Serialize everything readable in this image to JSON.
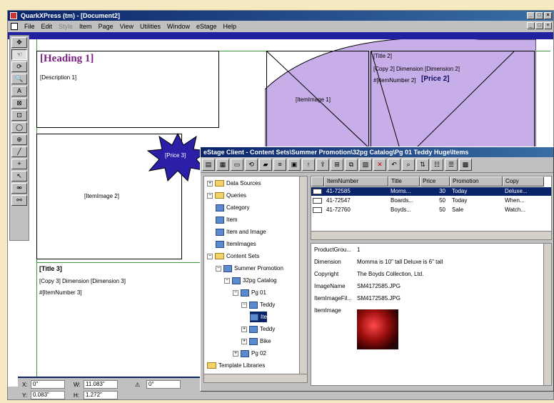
{
  "window": {
    "title": "QuarkXPress (tm) - [Document2]",
    "menus": [
      "File",
      "Edit",
      "Style",
      "Item",
      "Page",
      "View",
      "Utilities",
      "Window",
      "eStage",
      "Help"
    ]
  },
  "layout": {
    "heading": "[Heading 1]",
    "description": "[Description 1]",
    "itemimage_top": "[ItemImage 1]",
    "title2": "[Title 2]",
    "copy2": "[Copy 2] Dimension [Dimension 2]",
    "itemnumber2": "#[ItemNumber 2]",
    "price2": "[Price 2]",
    "star_price": "[Price 3]",
    "itemimage_mid": "[ItemImage 2]",
    "title3": "[Title 3]",
    "copy3": "[Copy 3] Dimension [Dimension 3]",
    "itemnumber3": "#[ItemNumber 3]"
  },
  "tools": [
    "✥",
    "☜",
    "⟳",
    "🔍",
    "A",
    "⊠",
    "⊡",
    "◯",
    "⊕",
    "╱",
    "+",
    "↖",
    "⚮",
    "⚯"
  ],
  "dialog": {
    "title": "eStage Client - Content Sets\\Summer Promotion\\32pg Catalog\\Pg 01 Teddy Huge\\Items",
    "tree": [
      {
        "label": "Data Sources",
        "icon": "folder",
        "exp": "+",
        "level": 0
      },
      {
        "label": "Queries",
        "icon": "folder",
        "exp": "−",
        "level": 0
      },
      {
        "label": "Category",
        "icon": "node",
        "exp": "",
        "level": 1
      },
      {
        "label": "Item",
        "icon": "node",
        "exp": "",
        "level": 1
      },
      {
        "label": "Item and Image",
        "icon": "node",
        "exp": "",
        "level": 1
      },
      {
        "label": "ItemImages",
        "icon": "node",
        "exp": "",
        "level": 1
      },
      {
        "label": "Content Sets",
        "icon": "folder",
        "exp": "−",
        "level": 0
      },
      {
        "label": "Summer Promotion",
        "icon": "node",
        "exp": "−",
        "level": 1
      },
      {
        "label": "32pg Catalog",
        "icon": "node",
        "exp": "−",
        "level": 2
      },
      {
        "label": "Pg 01",
        "icon": "node",
        "exp": "−",
        "level": 3
      },
      {
        "label": "Teddy",
        "icon": "node",
        "exp": "−",
        "level": 4
      },
      {
        "label": "Ite",
        "icon": "node",
        "exp": "",
        "level": 5,
        "selected": true
      },
      {
        "label": "Teddy",
        "icon": "node",
        "exp": "+",
        "level": 4
      },
      {
        "label": "Bike",
        "icon": "node",
        "exp": "+",
        "level": 4
      },
      {
        "label": "Pg 02",
        "icon": "node",
        "exp": "+",
        "level": 3
      },
      {
        "label": "Template Libraries",
        "icon": "folder",
        "exp": "",
        "level": 0
      }
    ],
    "columns": [
      "ItemNumber",
      "Title",
      "Price",
      "Promotion",
      "Copy"
    ],
    "rows": [
      [
        "41-72585",
        "Moms...",
        "30",
        "Today",
        "Deluxe..."
      ],
      [
        "41-72547",
        "Boards...",
        "50",
        "Today",
        "When..."
      ],
      [
        "41-72760",
        "Boyds...",
        "50",
        "Sale",
        "Watch..."
      ]
    ],
    "details": [
      [
        "ProductGrou...",
        "1"
      ],
      [
        "Dimension",
        "Momma is 10\" tall Deluxe is 6\" tall"
      ],
      [
        "Copyright",
        "The Boyds Collection, Ltd."
      ],
      [
        "ImageName",
        "SM4172585.JPG"
      ],
      [
        "ItemImageFil...",
        "SM4172585.JPG"
      ],
      [
        "ItemImage",
        ""
      ]
    ]
  },
  "measure": {
    "x_label": "X:",
    "x": "0\"",
    "y_label": "Y:",
    "y": "0.083\"",
    "w_label": "W:",
    "w": "11.083\"",
    "h_label": "H:",
    "h": "1.272\"",
    "angle_label": "⚠",
    "angle": "0°"
  }
}
